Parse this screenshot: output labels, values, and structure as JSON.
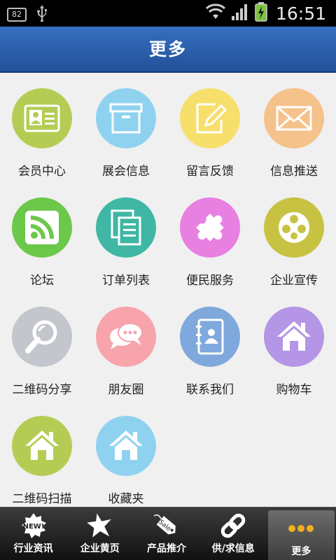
{
  "status_bar": {
    "battery_badge": "82",
    "time": "16:51"
  },
  "header": {
    "title": "更多"
  },
  "grid": {
    "items": [
      {
        "label": "会员中心",
        "icon": "member-card-icon",
        "color": "#b5cc54"
      },
      {
        "label": "展会信息",
        "icon": "archive-box-icon",
        "color": "#8fd2f0"
      },
      {
        "label": "留言反馈",
        "icon": "edit-note-icon",
        "color": "#f7df6b"
      },
      {
        "label": "信息推送",
        "icon": "envelope-icon",
        "color": "#f6c28b"
      },
      {
        "label": "论坛",
        "icon": "rss-feed-icon",
        "color": "#6cc84a"
      },
      {
        "label": "订单列表",
        "icon": "document-list-icon",
        "color": "#3fb7a4"
      },
      {
        "label": "便民服务",
        "icon": "puzzle-icon",
        "color": "#e780e0"
      },
      {
        "label": "企业宣传",
        "icon": "film-reel-icon",
        "color": "#c8c242"
      },
      {
        "label": "二维码分享",
        "icon": "magnifier-icon",
        "color": "#c3c6cc"
      },
      {
        "label": "朋友圈",
        "icon": "chat-bubbles-icon",
        "color": "#f7a4ad"
      },
      {
        "label": "联系我们",
        "icon": "address-book-icon",
        "color": "#7fa8dc"
      },
      {
        "label": "购物车",
        "icon": "home-icon",
        "color": "#b495e6"
      },
      {
        "label": "二维码扫描",
        "icon": "home-icon",
        "color": "#b5cc54"
      },
      {
        "label": "收藏夹",
        "icon": "home-icon",
        "color": "#8fd2f0"
      }
    ]
  },
  "tab_bar": {
    "tabs": [
      {
        "label": "行业资讯",
        "icon": "new-badge-icon"
      },
      {
        "label": "企业黄页",
        "icon": "star-icon"
      },
      {
        "label": "产品推介",
        "icon": "sale-tag-icon",
        "tag_text": "Sale"
      },
      {
        "label": "供/求信息",
        "icon": "chain-link-icon"
      },
      {
        "label": "更多",
        "icon": "more-dots-icon",
        "active": true
      }
    ],
    "new_badge_text": "NEW!"
  }
}
